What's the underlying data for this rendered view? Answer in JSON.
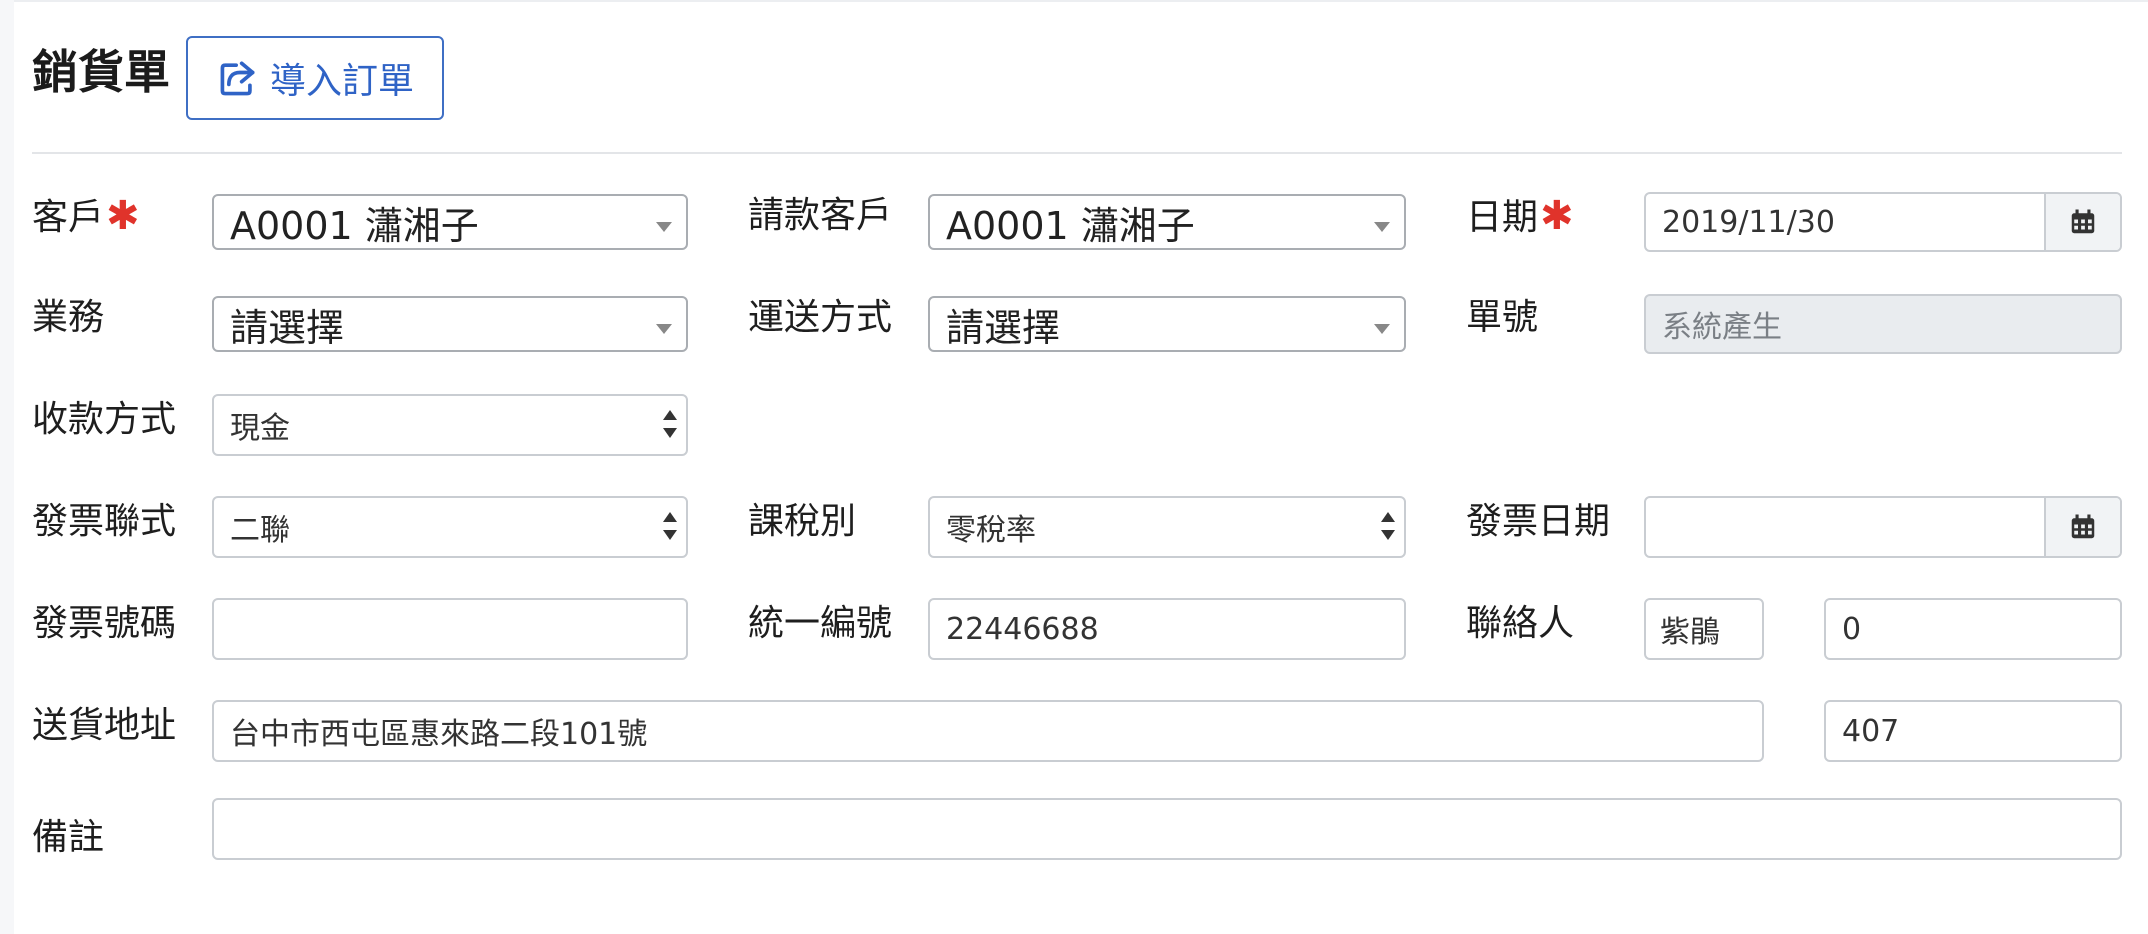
{
  "header": {
    "title": "銷貨單",
    "import_button_label": "導入訂單",
    "import_icon": "share-icon"
  },
  "form": {
    "customer": {
      "label": "客戶",
      "required_mark": "✱",
      "value": "A0001 瀟湘子"
    },
    "billing_customer": {
      "label": "請款客戶",
      "value": "A0001 瀟湘子"
    },
    "date": {
      "label": "日期",
      "required_mark": "✱",
      "value": "2019/11/30",
      "icon": "calendar-icon"
    },
    "salesperson": {
      "label": "業務",
      "value": "請選擇"
    },
    "shipping_method": {
      "label": "運送方式",
      "value": "請選擇"
    },
    "order_number": {
      "label": "單號",
      "placeholder": "系統產生"
    },
    "payment_method": {
      "label": "收款方式",
      "value": "現金"
    },
    "invoice_type": {
      "label": "發票聯式",
      "value": "二聯"
    },
    "tax_type": {
      "label": "課稅別",
      "value": "零稅率"
    },
    "invoice_date": {
      "label": "發票日期",
      "value": "",
      "icon": "calendar-icon"
    },
    "invoice_number": {
      "label": "發票號碼",
      "value": ""
    },
    "tax_id": {
      "label": "統一編號",
      "value": "22446688"
    },
    "contact": {
      "label": "聯絡人",
      "name": "紫鵑",
      "phone": "0"
    },
    "delivery_address": {
      "label": "送貨地址",
      "address": "台中市西屯區惠來路二段101號",
      "zip": "407"
    },
    "remarks": {
      "label": "備註",
      "value": ""
    }
  },
  "colors": {
    "accent": "#2f63c6",
    "required": "#e0332b",
    "border": "#c9cdd2",
    "disabled_bg": "#e9ecef"
  }
}
